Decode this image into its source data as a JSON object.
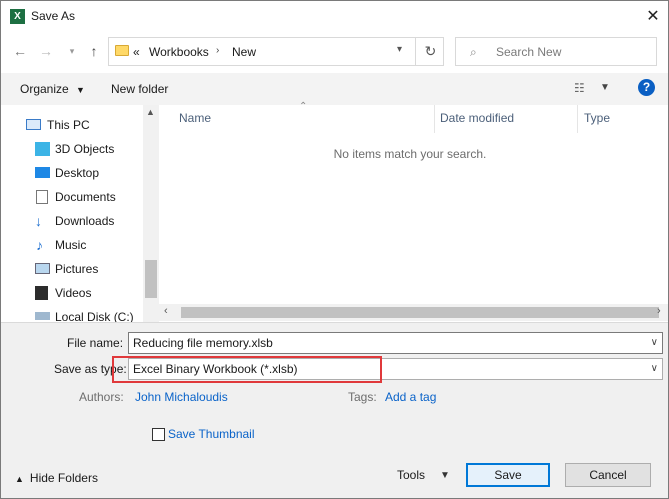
{
  "dialog": {
    "title": "Save As",
    "app_icon": "X"
  },
  "address": {
    "overflow": "«",
    "crumbs": [
      "Workbooks",
      "New"
    ],
    "search_placeholder": "Search New"
  },
  "toolbar": {
    "organize": "Organize",
    "new_folder": "New folder",
    "help": "?"
  },
  "nav": {
    "items": [
      {
        "label": "This PC",
        "icon": "computer-icon"
      },
      {
        "label": "3D Objects",
        "icon": "3d-objects-icon"
      },
      {
        "label": "Desktop",
        "icon": "desktop-icon"
      },
      {
        "label": "Documents",
        "icon": "documents-icon"
      },
      {
        "label": "Downloads",
        "icon": "downloads-icon"
      },
      {
        "label": "Music",
        "icon": "music-icon"
      },
      {
        "label": "Pictures",
        "icon": "pictures-icon"
      },
      {
        "label": "Videos",
        "icon": "videos-icon"
      },
      {
        "label": "Local Disk (C:)",
        "icon": "drive-icon"
      }
    ]
  },
  "filelist": {
    "columns": [
      "Name",
      "Date modified",
      "Type"
    ],
    "empty_message": "No items match your search."
  },
  "form": {
    "file_name_label": "File name:",
    "file_name_value": "Reducing file memory.xlsb",
    "save_type_label": "Save as type:",
    "save_type_value": "Excel Binary Workbook (*.xlsb)",
    "authors_label": "Authors:",
    "authors_value": "John Michaloudis",
    "tags_label": "Tags:",
    "tags_value": "Add a tag",
    "thumbnail_label": "Save Thumbnail",
    "thumbnail_checked": false
  },
  "footer": {
    "hide_folders": "Hide Folders",
    "tools": "Tools",
    "save": "Save",
    "cancel": "Cancel"
  },
  "colors": {
    "accent": "#0078d7",
    "highlight_box": "#e0393b",
    "excel_green": "#1d6f42",
    "link": "#0a63c9"
  }
}
